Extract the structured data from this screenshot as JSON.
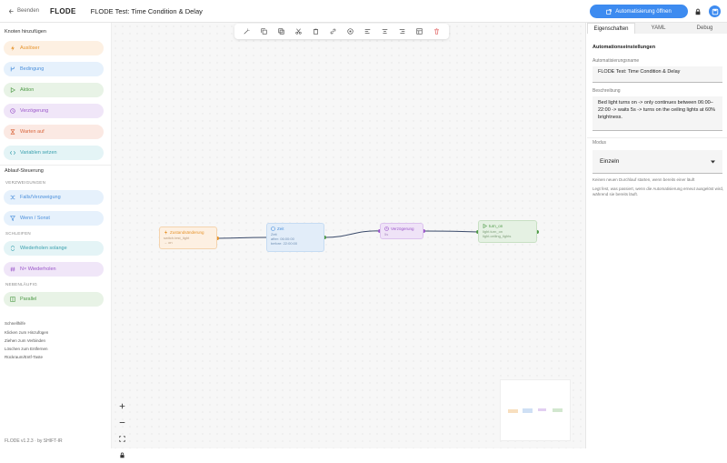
{
  "header": {
    "back_label": "Beenden",
    "logo": "FLODE",
    "title": "FLODE Test: Time Condition & Delay",
    "open_automation_label": "Automatisierung öffnen"
  },
  "sidebar": {
    "add_nodes_heading": "Knoten hinzufügen",
    "nodes": [
      {
        "label": "Auslöser",
        "icon": "lightning-icon"
      },
      {
        "label": "Bedingung",
        "icon": "branch-icon"
      },
      {
        "label": "Aktion",
        "icon": "play-icon"
      },
      {
        "label": "Verzögerung",
        "icon": "clock-icon"
      },
      {
        "label": "Warten auf",
        "icon": "hourglass-icon"
      },
      {
        "label": "Variablen setzen",
        "icon": "code-icon"
      }
    ],
    "flow_heading": "Ablauf-Steuerung",
    "branches_label": "VERZWEIGUNGEN",
    "branch_items": [
      {
        "label": "Falls/Verzweigung",
        "icon": "shuffle-icon"
      },
      {
        "label": "Wenn / Sonst",
        "icon": "filter-icon"
      }
    ],
    "loops_label": "SCHLEIFEN",
    "loop_items": [
      {
        "label": "Wiederholen solange",
        "icon": "loop-icon"
      },
      {
        "label": "N× Wiederholen",
        "icon": "hash-icon"
      }
    ],
    "parallel_label": "NEBENLÄUFIG",
    "parallel_items": [
      {
        "label": "Parallel",
        "icon": "columns-icon"
      }
    ],
    "tips_heading": "Schnellhilfe",
    "tips": [
      "Klicken zum Hinzufügen",
      "Ziehen zum Verbinden",
      "Löschen zum Entfernen",
      "Rückraum/Entf-Taste"
    ],
    "footer": "FLODE v1.2.3 · by SHIFT-IR"
  },
  "canvas": {
    "nodes": [
      {
        "title": "Zustandsänderung",
        "lines": [
          "switch.test_light",
          "→ on"
        ]
      },
      {
        "title": "Zeit",
        "lines": [
          "Zeit",
          "after: 06:00:00",
          "before: 22:00:00"
        ]
      },
      {
        "title": "Verzögerung",
        "lines": [
          "5s"
        ]
      },
      {
        "title": "turn_on",
        "lines": [
          "light.turn_on",
          "light.ceiling_lights"
        ]
      }
    ]
  },
  "right_panel": {
    "tabs": [
      "Eigenschaften",
      "YAML",
      "Debug"
    ],
    "section_title": "Automationseinstellungen",
    "name_label": "Automatisierungsname",
    "name_value": "FLODE Test: Time Condition & Delay",
    "desc_label": "Beschreibung",
    "desc_value": "Bed light turns on -> only continues between 06:00–22:00 -> waits 5s -> turns on the ceiling lights at 60% brightness.",
    "mode_label": "Modus",
    "mode_value": "Einzeln",
    "help1": "Keinen neuen Durchlauf starten, wenn bereits einer läuft",
    "help2": "Legt fest, was passiert, wenn die Automatisierung erneut ausgelöst wird, während sie bereits läuft."
  },
  "colors": {
    "accent": "#3d8bf0",
    "trigger": "#e6932b",
    "condition": "#4a8fdb",
    "action": "#4f9a48",
    "delay": "#9a55c9"
  }
}
